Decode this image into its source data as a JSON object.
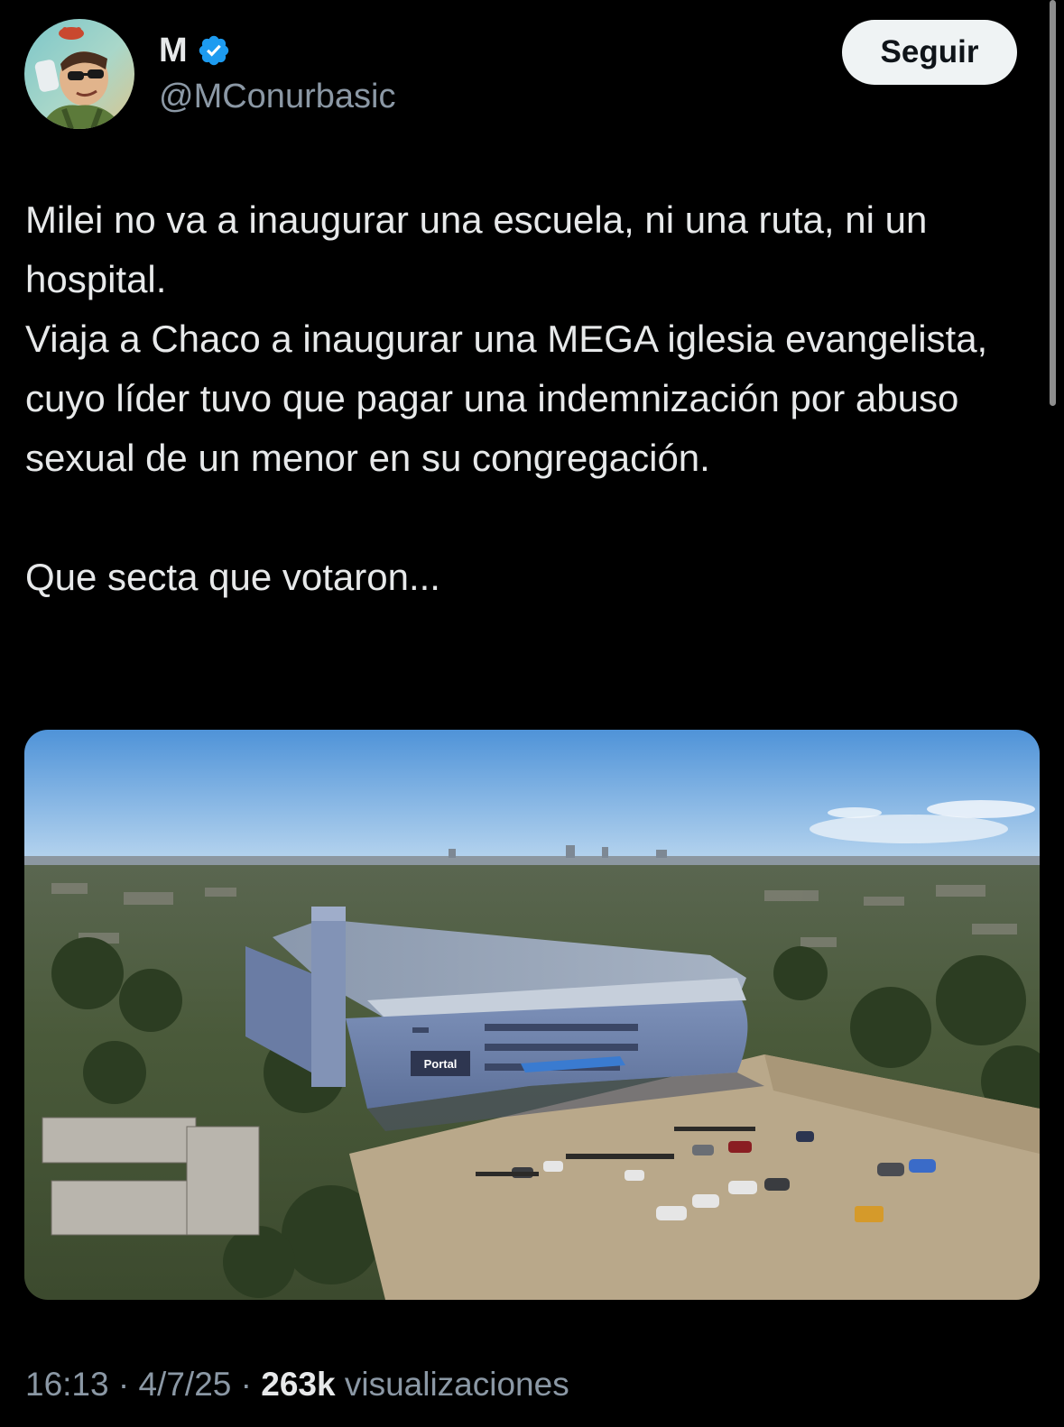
{
  "author": {
    "display_name": "M",
    "handle": "@MConurbasic",
    "verified": true
  },
  "follow_button": {
    "label": "Seguir"
  },
  "tweet": {
    "paragraphs": [
      "Milei no va a inaugurar una escuela, ni una ruta, ni un hospital.",
      "Viaja a Chaco a inaugurar una MEGA iglesia evangelista, cuyo líder tuvo que pagar una indemnización por abuso sexual de un menor en su congregación.",
      "Que secta que votaron..."
    ],
    "media": {
      "sign_text": "Portal"
    }
  },
  "meta": {
    "time": "16:13",
    "separator": "·",
    "date": "4/7/25",
    "views_count": "263k",
    "views_label": "visualizaciones"
  },
  "colors": {
    "background": "#000000",
    "text": "#e7e9ea",
    "secondary_text": "#8b98a5",
    "verified_badge": "#1d9bf0",
    "button_bg": "#eff3f4"
  }
}
